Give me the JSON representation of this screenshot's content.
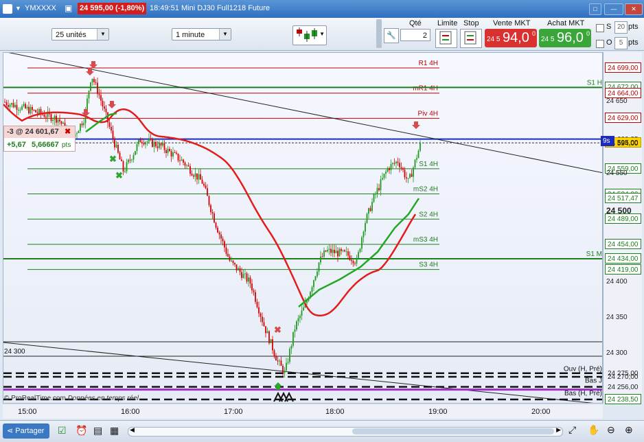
{
  "window": {
    "symbol": "YMXXXX",
    "price_badge": "24 595,00 (-1,80%)",
    "time": "18:49:51",
    "instrument": "Mini DJ30 Full1218 Future"
  },
  "toolbar": {
    "units_select": "25 unités",
    "interval_select": "1 minute",
    "qty_label": "Qté",
    "qty_value": "2",
    "limit_label": "Limite",
    "stop_label": "Stop",
    "sell_label": "Vente MKT",
    "sell_prefix": "24 5",
    "sell_big": "94,0",
    "sell_sup": "0",
    "buy_label": "Achat MKT",
    "buy_prefix": "24 5",
    "buy_big": "96,0",
    "buy_sup": "0",
    "s_label": "S",
    "s_pts": "20",
    "o_label": "O",
    "o_pts": "5",
    "pts_label": "pts"
  },
  "position": {
    "order": "-3 @ 24 601,67",
    "pnl": "+5,67",
    "pnl_pts": "5,66667",
    "pts": "pts"
  },
  "levels": [
    {
      "name": "R1 4H",
      "price": 24699,
      "color": "#c00000",
      "width": 1
    },
    {
      "name": "mR1 4H",
      "price": 24664,
      "color": "#c00000",
      "width": 1
    },
    {
      "name": "Piv 4H",
      "price": 24629,
      "color": "#c00000",
      "width": 1
    },
    {
      "name": "S1 4H",
      "price": 24559,
      "color": "#1e7d1e",
      "width": 1
    },
    {
      "name": "mS2 4H",
      "price": 24524,
      "color": "#1e7d1e",
      "width": 1
    },
    {
      "name": "S2 4H",
      "price": 24489,
      "color": "#1e7d1e",
      "width": 1
    },
    {
      "name": "mS3 4H",
      "price": 24454,
      "color": "#1e7d1e",
      "width": 1
    },
    {
      "name": "S3 4H",
      "price": 24419,
      "color": "#1e7d1e",
      "width": 1
    }
  ],
  "full_levels": [
    {
      "name": "S1 H",
      "price": 24672,
      "color": "#1e7d1e"
    },
    {
      "name": "S1 M",
      "price": 24434,
      "color": "#1e7d1e"
    }
  ],
  "dashed_labels": [
    "Ouv (H, Pré)",
    "Bas J",
    "Bas (H, Pré)"
  ],
  "price_label_24300": "24 300",
  "y_ticks": [
    "24 650",
    "24 550",
    "24 500",
    "24 400",
    "24 350",
    "24 300"
  ],
  "y_boxes": [
    {
      "text": "24 699,00",
      "style": "red"
    },
    {
      "text": "24 672,00",
      "style": "green"
    },
    {
      "text": "24 664,00",
      "style": "red"
    },
    {
      "text": "24 629,00",
      "style": "red"
    },
    {
      "text": "24 600,25",
      "style": "plain"
    },
    {
      "text": "24 595,00",
      "style": "yellow"
    },
    {
      "text": "24 594,00",
      "style": "plain"
    },
    {
      "text": "24 559,00",
      "style": "green"
    },
    {
      "text": "24 524,00",
      "style": "green"
    },
    {
      "text": "24 517,47",
      "style": "green"
    },
    {
      "text": "24 489,00",
      "style": "green"
    },
    {
      "text": "24 454,00",
      "style": "green"
    },
    {
      "text": "24 434,00",
      "style": "green"
    },
    {
      "text": "24 419,00",
      "style": "green"
    },
    {
      "text": "24 275,00",
      "style": "plain"
    },
    {
      "text": "24 270,00",
      "style": "plain"
    },
    {
      "text": "24 256,00",
      "style": "plain"
    },
    {
      "text": "24 238,50",
      "style": "green"
    }
  ],
  "current_tag": "9s",
  "x_ticks": [
    "15:00",
    "16:00",
    "17:00",
    "18:00",
    "19:00",
    "20:00"
  ],
  "watermark": "© ProRealTime.com",
  "watermark2": "Données en temps réel",
  "bottom": {
    "share_label": "Partager"
  },
  "colors": {
    "bull": "#1e9a1e",
    "bear": "#d40000",
    "ma_red": "#e31b1b",
    "ma_green": "#22a722",
    "sell_bg": "#d9312f",
    "buy_bg": "#3aa63a"
  }
}
